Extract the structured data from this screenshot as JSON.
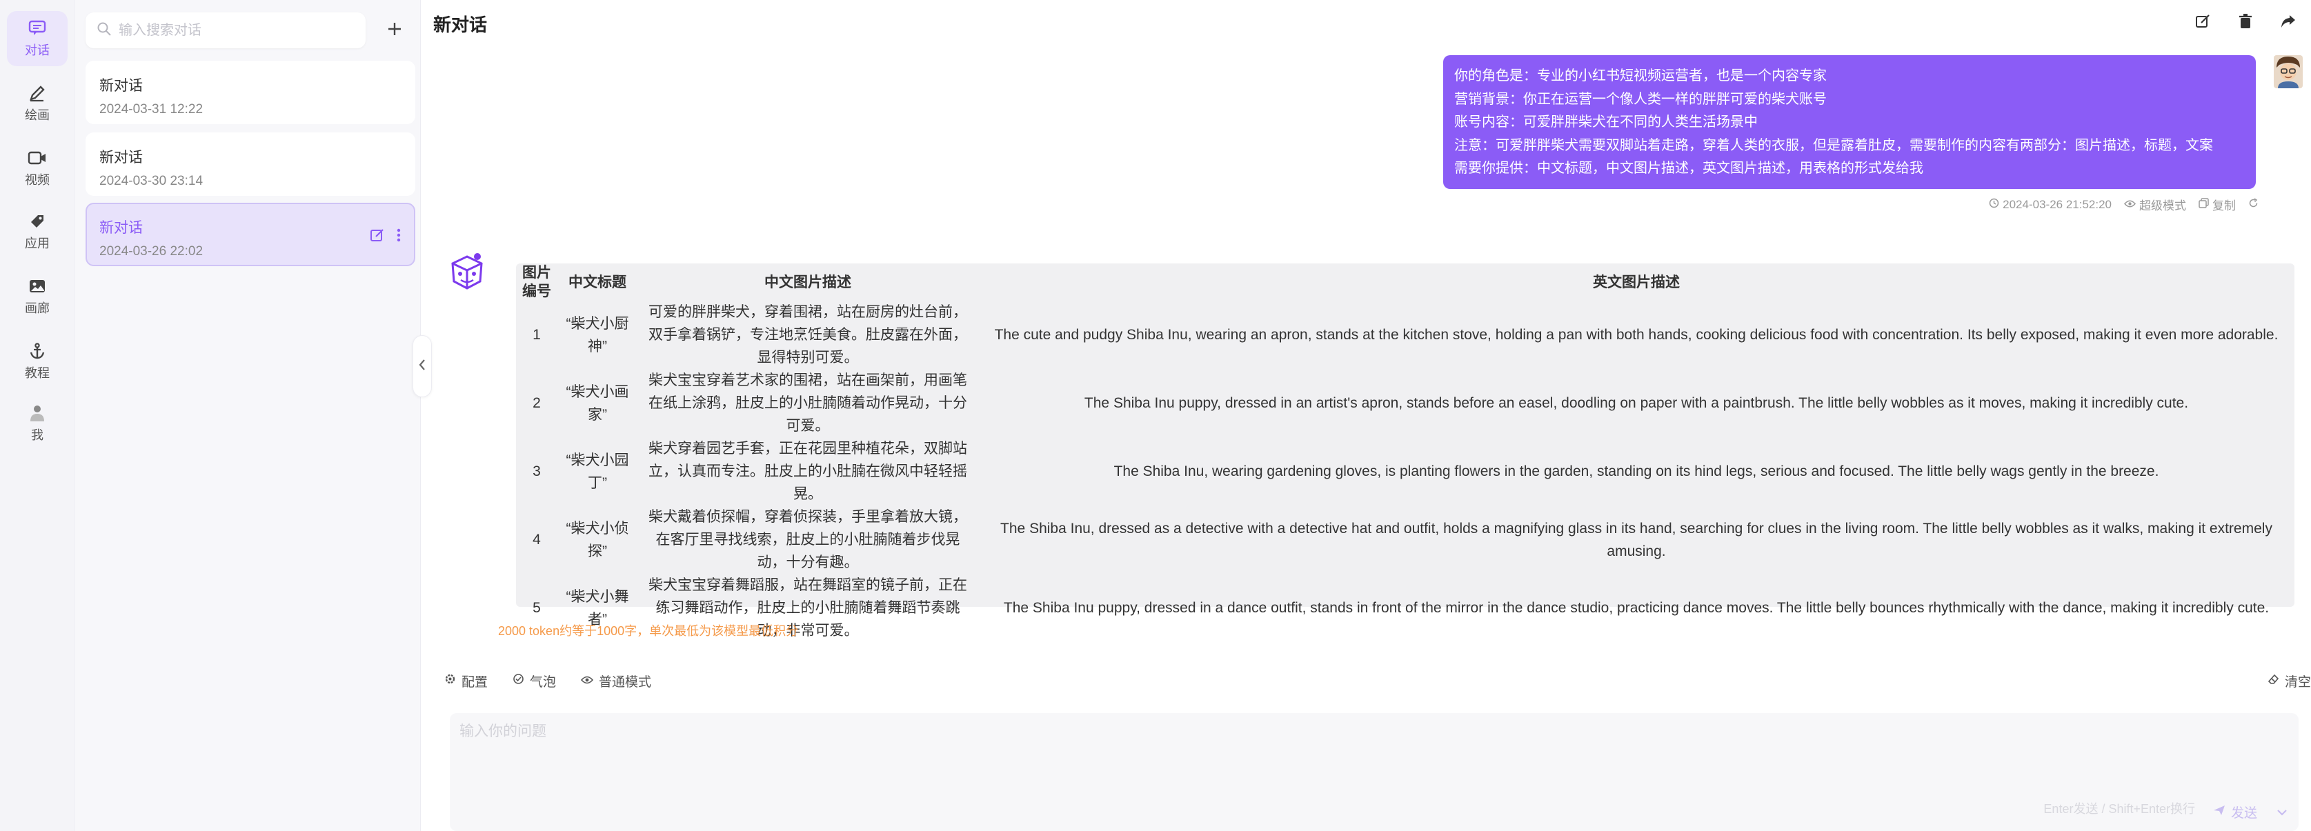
{
  "rail": {
    "items": [
      {
        "label": "对话",
        "icon": "chat-icon",
        "active": true
      },
      {
        "label": "绘画",
        "icon": "brush-icon",
        "active": false
      },
      {
        "label": "视频",
        "icon": "video-icon",
        "active": false
      },
      {
        "label": "应用",
        "icon": "app-icon",
        "active": false
      },
      {
        "label": "画廊",
        "icon": "gallery-icon",
        "active": false
      },
      {
        "label": "教程",
        "icon": "anchor-icon",
        "active": false
      },
      {
        "label": "我",
        "icon": "user-icon",
        "active": false
      }
    ]
  },
  "sidebar": {
    "search_placeholder": "输入搜索对话",
    "conversations": [
      {
        "title": "新对话",
        "date": "2024-03-31 12:22"
      },
      {
        "title": "新对话",
        "date": "2024-03-30 23:14"
      },
      {
        "title": "新对话",
        "date": "2024-03-26 22:02"
      }
    ]
  },
  "header": {
    "title": "新对话"
  },
  "user_message": {
    "lines": [
      "你的角色是：专业的小红书短视频运营者，也是一个内容专家",
      "营销背景：你正在运营一个像人类一样的胖胖可爱的柴犬账号",
      "账号内容：可爱胖胖柴犬在不同的人类生活场景中",
      "注意：可爱胖胖柴犬需要双脚站着走路，穿着人类的衣服，但是露着肚皮，需要制作的内容有两部分：图片描述，标题，文案",
      "需要你提供：中文标题，中文图片描述，英文图片描述，用表格的形式发给我"
    ],
    "time": "2024-03-26 21:52:20",
    "mode": "超级模式",
    "copy": "复制"
  },
  "answer_table": {
    "headers": [
      "图片编号",
      "中文标题",
      "中文图片描述",
      "英文图片描述"
    ],
    "rows": [
      {
        "num": "1",
        "title": "“柴犬小厨神”",
        "cn": "可爱的胖胖柴犬，穿着围裙，站在厨房的灶台前，双手拿着锅铲，专注地烹饪美食。肚皮露在外面，显得特别可爱。",
        "en": "The cute and pudgy Shiba Inu, wearing an apron, stands at the kitchen stove, holding a pan with both hands, cooking delicious food with concentration. Its belly exposed, making it even more adorable."
      },
      {
        "num": "2",
        "title": "“柴犬小画家”",
        "cn": "柴犬宝宝穿着艺术家的围裙，站在画架前，用画笔在纸上涂鸦，肚皮上的小肚腩随着动作晃动，十分可爱。",
        "en": "The Shiba Inu puppy, dressed in an artist's apron, stands before an easel, doodling on paper with a paintbrush. The little belly wobbles as it moves, making it incredibly cute."
      },
      {
        "num": "3",
        "title": "“柴犬小园丁”",
        "cn": "柴犬穿着园艺手套，正在花园里种植花朵，双脚站立，认真而专注。肚皮上的小肚腩在微风中轻轻摇晃。",
        "en": "The Shiba Inu, wearing gardening gloves, is planting flowers in the garden, standing on its hind legs, serious and focused. The little belly wags gently in the breeze."
      },
      {
        "num": "4",
        "title": "“柴犬小侦探”",
        "cn": "柴犬戴着侦探帽，穿着侦探装，手里拿着放大镜，在客厅里寻找线索，肚皮上的小肚腩随着步伐晃动，十分有趣。",
        "en": "The Shiba Inu, dressed as a detective with a detective hat and outfit, holds a magnifying glass in its hand, searching for clues in the living room. The little belly wobbles as it walks, making it extremely amusing."
      },
      {
        "num": "5",
        "title": "“柴犬小舞者”",
        "cn": "柴犬宝宝穿着舞蹈服，站在舞蹈室的镜子前，正在练习舞蹈动作，肚皮上的小肚腩随着舞蹈节奏跳动，非常可爱。",
        "en": "The Shiba Inu puppy, dressed in a dance outfit, stands in front of the mirror in the dance studio, practicing dance moves. The little belly bounces rhythmically with the dance, making it incredibly cute."
      }
    ]
  },
  "warning": "2000 token约等于1000字，单次最低为该模型最低积分",
  "toolbar": {
    "config": "配置",
    "bubble": "气泡",
    "mode": "普通模式",
    "clear": "清空"
  },
  "composer": {
    "placeholder": "输入你的问题",
    "hint": "Enter发送 / Shift+Enter换行",
    "send": "发送"
  },
  "colors": {
    "accent": "#8b5cf6",
    "warning": "#f59a4a"
  }
}
